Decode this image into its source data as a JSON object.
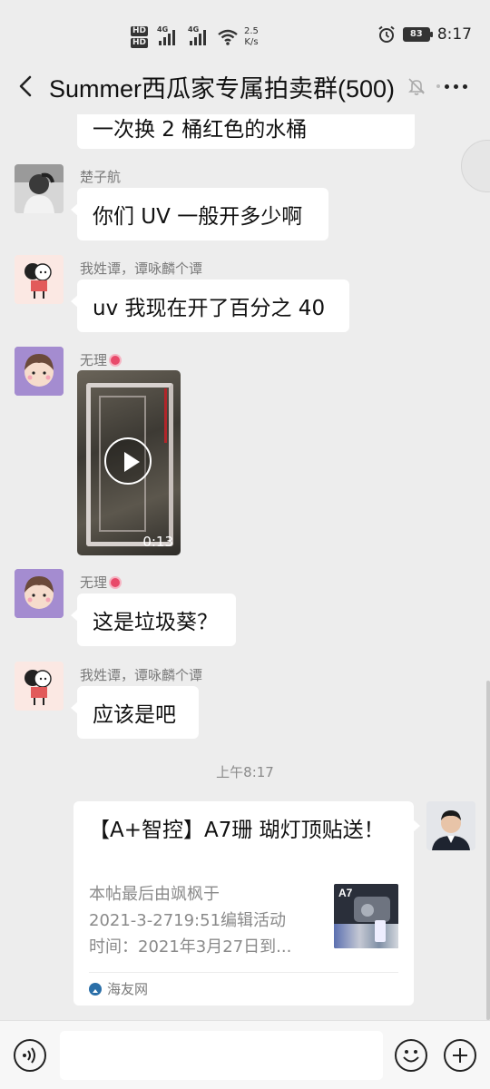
{
  "status_bar": {
    "hd_top": "HD",
    "hd_bottom": "HD",
    "network_1": "4G",
    "network_2": "4G",
    "speed_value": "2.5",
    "speed_unit": "K/s",
    "battery": "83",
    "time": "8:17",
    "icons": [
      "hd-icon",
      "signal-icon",
      "wifi-icon",
      "alarm-icon",
      "battery-icon"
    ]
  },
  "header": {
    "back_icon": "chevron-left-icon",
    "title": "Summer西瓜家专属拍卖群(500)",
    "mute_icon": "bell-off-icon",
    "more_icon": "more-icon"
  },
  "messages": [
    {
      "type": "text",
      "sender": "",
      "text": "一次换 2 桶红色的水桶"
    },
    {
      "type": "text",
      "sender": "楚子航",
      "text": "你们 UV 一般开多少啊"
    },
    {
      "type": "text",
      "sender": "我姓谭，谭咏麟个谭",
      "text": "uv 我现在开了百分之 40"
    },
    {
      "type": "video",
      "sender": "无理",
      "duration": "0:13"
    },
    {
      "type": "text",
      "sender": "无理",
      "text": "这是垃圾葵？"
    },
    {
      "type": "text",
      "sender": "我姓谭，谭咏麟个谭",
      "text": "应该是吧"
    }
  ],
  "time_separator": "上午8:17",
  "link_card": {
    "title": "【A+智控】A7珊 瑚灯顶贴送！",
    "desc_lines": [
      "本帖最后由飒枫于",
      "2021-3-2719:51编辑活动",
      "时间：2021年3月27日到..."
    ],
    "thumb_label": "A7",
    "source": "海友网"
  },
  "input_bar": {
    "placeholder": "",
    "icons": [
      "voice-icon",
      "emoji-icon",
      "plus-icon"
    ]
  },
  "colors": {
    "background": "#ededed",
    "bubble": "#ffffff",
    "sender_name": "#7a7a7a",
    "badge": "#e84a6a"
  }
}
